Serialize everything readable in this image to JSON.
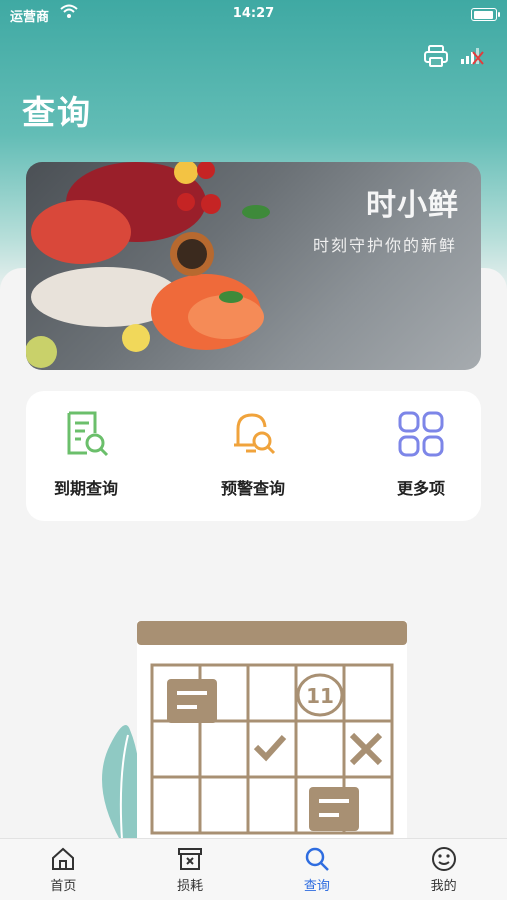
{
  "status_bar": {
    "carrier": "运营商",
    "time": "14:27"
  },
  "header": {
    "title": "查询"
  },
  "banner": {
    "brand": "时小鲜",
    "slogan": "时刻守护你的新鲜"
  },
  "quick_actions": [
    {
      "label": "到期查询",
      "icon": "document-search-icon",
      "color": "#6bbf6b"
    },
    {
      "label": "预警查询",
      "icon": "bell-search-icon",
      "color": "#f0a33c"
    },
    {
      "label": "更多项",
      "icon": "grid-icon",
      "color": "#7d86e8"
    }
  ],
  "illustration": {
    "calendar_number": "11"
  },
  "tabbar": {
    "active": "查询",
    "items": [
      {
        "label": "首页",
        "icon": "home-icon"
      },
      {
        "label": "损耗",
        "icon": "trash-box-icon"
      },
      {
        "label": "查询",
        "icon": "search-icon"
      },
      {
        "label": "我的",
        "icon": "smile-icon"
      }
    ]
  },
  "colors": {
    "header": "#3fa9a3",
    "accent": "#2f6de0",
    "calendar": "#a89073"
  }
}
